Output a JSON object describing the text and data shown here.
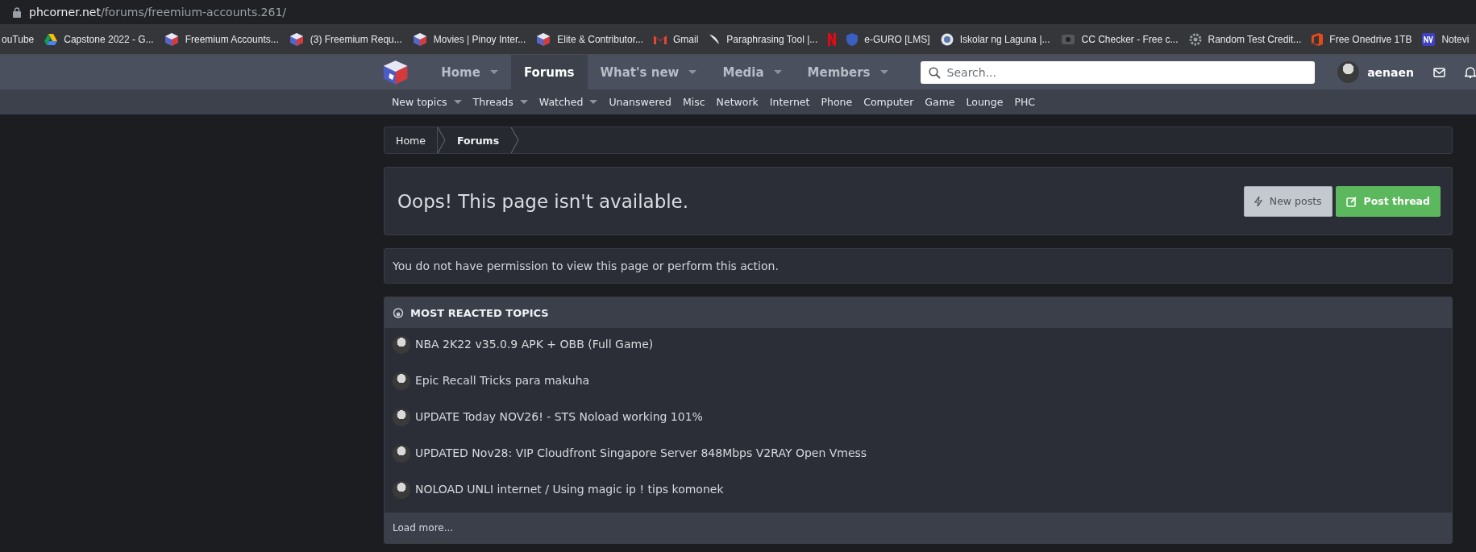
{
  "address_bar": {
    "host": "phcorner.net",
    "path": "/forums/freemium-accounts.261/"
  },
  "bookmarks": [
    {
      "kind": "link",
      "title": "ouTube"
    },
    {
      "kind": "link",
      "title": "Capstone 2022 - G..."
    },
    {
      "kind": "link",
      "title": "Freemium Accounts..."
    },
    {
      "kind": "link",
      "title": "(3) Freemium Requ..."
    },
    {
      "kind": "link",
      "title": "Movies | Pinoy Inter..."
    },
    {
      "kind": "link",
      "title": "Elite & Contributor..."
    },
    {
      "kind": "link",
      "title": "Gmail"
    },
    {
      "kind": "link",
      "title": "Paraphrasing Tool |..."
    },
    {
      "kind": "icon"
    },
    {
      "kind": "link",
      "title": "e-GURO [LMS]"
    },
    {
      "kind": "link",
      "title": "Iskolar ng Laguna |..."
    },
    {
      "kind": "link",
      "title": "CC Checker - Free c..."
    },
    {
      "kind": "link",
      "title": "Random Test Credit..."
    },
    {
      "kind": "link",
      "title": "Free Onedrive 1TB"
    },
    {
      "kind": "link",
      "title": "Notevi"
    }
  ],
  "nav": [
    {
      "label": "Home",
      "selected": false,
      "has_menu": true
    },
    {
      "label": "Forums",
      "selected": true,
      "has_menu": false
    },
    {
      "label": "What's new",
      "selected": false,
      "has_menu": true
    },
    {
      "label": "Media",
      "selected": false,
      "has_menu": true
    },
    {
      "label": "Members",
      "selected": false,
      "has_menu": true
    }
  ],
  "search": {
    "placeholder": "Search..."
  },
  "user": {
    "name": "aenaen"
  },
  "subnav": [
    {
      "label": "New topics",
      "has_menu": true
    },
    {
      "label": "Threads",
      "has_menu": true
    },
    {
      "label": "Watched",
      "has_menu": true
    },
    {
      "label": "Unanswered",
      "has_menu": false
    },
    {
      "label": "Misc",
      "has_menu": false
    },
    {
      "label": "Network",
      "has_menu": false
    },
    {
      "label": "Internet",
      "has_menu": false
    },
    {
      "label": "Phone",
      "has_menu": false
    },
    {
      "label": "Computer",
      "has_menu": false
    },
    {
      "label": "Game",
      "has_menu": false
    },
    {
      "label": "Lounge",
      "has_menu": false
    },
    {
      "label": "PHC",
      "has_menu": false
    }
  ],
  "breadcrumbs": [
    {
      "label": "Home",
      "current": false
    },
    {
      "label": "Forums",
      "current": true
    }
  ],
  "page_title": "Oops! This page isn't available.",
  "buttons": [
    {
      "kind": "secondary",
      "label": "New posts"
    },
    {
      "kind": "primary",
      "label": "Post thread"
    }
  ],
  "message": "You do not have permission to view this page or perform this action.",
  "topics": {
    "title": "MOST REACTED TOPICS",
    "items": [
      "NBA 2K22 v35.0.9 APK + OBB (Full Game)",
      "Epic Recall Tricks para makuha",
      "UPDATE Today NOV26! - STS Noload working 101%",
      "UPDATED Nov28: VIP Cloudfront Singapore Server 848Mbps V2RAY Open Vmess",
      "NOLOAD UNLI internet / Using magic ip ! tips komonek"
    ],
    "load_more": "Load more..."
  }
}
